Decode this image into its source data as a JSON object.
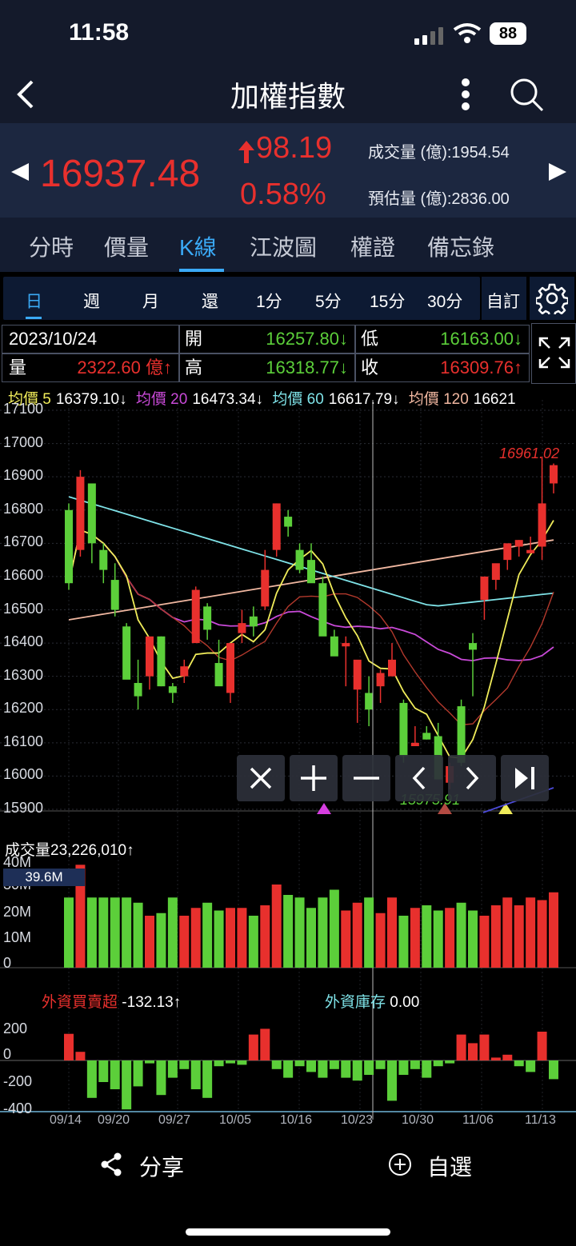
{
  "status_bar": {
    "time": "11:58",
    "battery": "88"
  },
  "header": {
    "title": "加權指數"
  },
  "quote": {
    "price": "16937.48",
    "change": "98.19",
    "change_pct": "0.58%",
    "volume_label": "成交量 (億):1954.54",
    "est_volume_label": "預估量 (億):2836.00"
  },
  "tabs": [
    "分時",
    "價量",
    "K線",
    "江波圖",
    "權證",
    "備忘錄"
  ],
  "active_tab": "K線",
  "periods": [
    "日",
    "週",
    "月",
    "還",
    "1分",
    "5分",
    "15分",
    "30分"
  ],
  "active_period": "日",
  "custom_label": "自訂",
  "ohlc": {
    "date": "2023/10/24",
    "open_label": "開",
    "open": "16257.80↓",
    "low_label": "低",
    "low": "16163.00↓",
    "vol_label": "量",
    "vol": "2322.60 億↑",
    "high_label": "高",
    "high": "16318.77↓",
    "close_label": "收",
    "close": "16309.76↑"
  },
  "ma": [
    {
      "label": "均價 5",
      "value": "16379.10↓",
      "color": "#f0ec5a"
    },
    {
      "label": "均價 20",
      "value": "16473.34↓",
      "color": "#c94ad8"
    },
    {
      "label": "均價 60",
      "value": "16617.79↓",
      "color": "#7fe3e8"
    },
    {
      "label": "均價 120",
      "value": "16621",
      "color": "#f0b7a0"
    }
  ],
  "price_axis": [
    "17100",
    "17000",
    "16900",
    "16800",
    "16700",
    "16600",
    "16500",
    "16400",
    "16300",
    "16200",
    "16100",
    "16000",
    "15900"
  ],
  "high_marker": "16961.02",
  "low_marker": "15975.91",
  "volume": {
    "label": "成交量",
    "value": "23,226,010↑",
    "axis": [
      "40M",
      "30M",
      "20M",
      "10M",
      "0"
    ],
    "cursor_value": "39.6M"
  },
  "foreign": {
    "label": "外資買賣超",
    "value": "-132.13↑",
    "inv_label": "外資庫存",
    "inv_value": "0.00",
    "axis": [
      "200",
      "0",
      "-200",
      "-400"
    ]
  },
  "dates": [
    "09/14",
    "09/20",
    "09/27",
    "10/05",
    "10/16",
    "10/23",
    "10/30",
    "11/06",
    "11/13"
  ],
  "bottom": {
    "share": "分享",
    "watch": "自選"
  },
  "chart_data": {
    "type": "candlestick",
    "candles": [
      [
        16800,
        16820,
        16560,
        16580
      ],
      [
        16680,
        16920,
        16660,
        16900
      ],
      [
        16880,
        16880,
        16640,
        16700
      ],
      [
        16680,
        16700,
        16580,
        16620
      ],
      [
        16590,
        16640,
        16480,
        16500
      ],
      [
        16450,
        16460,
        16300,
        16290
      ],
      [
        16280,
        16350,
        16200,
        16240
      ],
      [
        16300,
        16400,
        16260,
        16420
      ],
      [
        16420,
        16420,
        16270,
        16270
      ],
      [
        16270,
        16280,
        16220,
        16250
      ],
      [
        16300,
        16350,
        16280,
        16330
      ],
      [
        16400,
        16570,
        16420,
        16560
      ],
      [
        16510,
        16520,
        16410,
        16440
      ],
      [
        16340,
        16410,
        16280,
        16270
      ],
      [
        16250,
        16360,
        16220,
        16400
      ],
      [
        16430,
        16500,
        16400,
        16460
      ],
      [
        16480,
        16510,
        16420,
        16450
      ],
      [
        16510,
        16680,
        16500,
        16620
      ],
      [
        16680,
        16820,
        16660,
        16820
      ],
      [
        16780,
        16800,
        16720,
        16750
      ],
      [
        16680,
        16700,
        16610,
        16620
      ],
      [
        16650,
        16700,
        16590,
        16580
      ],
      [
        16580,
        16600,
        16450,
        16420
      ],
      [
        16420,
        16440,
        16400,
        16360
      ],
      [
        16390,
        16420,
        16270,
        16400
      ],
      [
        16260,
        16320,
        16160,
        16350
      ],
      [
        16250,
        16300,
        16150,
        16200
      ],
      [
        16270,
        16320,
        16220,
        16310
      ],
      [
        16300,
        16400,
        16300,
        16350
      ],
      [
        16220,
        16230,
        16040,
        16060
      ],
      [
        16090,
        16150,
        16090,
        16100
      ],
      [
        16130,
        16150,
        16110,
        16110
      ],
      [
        16120,
        16160,
        15990,
        15990
      ],
      [
        15980,
        16040,
        15960,
        16030
      ],
      [
        16210,
        16230,
        16030,
        16040
      ],
      [
        16400,
        16430,
        16240,
        16380
      ],
      [
        16530,
        16600,
        16470,
        16600
      ],
      [
        16590,
        16630,
        16560,
        16640
      ],
      [
        16650,
        16690,
        16620,
        16700
      ],
      [
        16690,
        16710,
        16660,
        16710
      ],
      [
        16670,
        16720,
        16670,
        16680
      ],
      [
        16690,
        16960,
        16650,
        16820
      ],
      [
        16880,
        16940,
        16850,
        16935
      ]
    ],
    "volume_M": [
      27,
      39.6,
      27,
      27,
      27,
      27,
      25,
      20,
      21,
      27,
      20,
      23,
      25,
      22,
      23,
      23,
      20,
      24,
      32,
      28,
      27,
      23,
      27,
      30,
      22,
      25,
      27,
      21,
      27,
      20,
      23,
      24,
      22,
      23,
      25,
      22,
      20,
      24,
      27,
      24,
      27,
      26,
      29
    ],
    "foreign_net": [
      185,
      60,
      -260,
      -150,
      -200,
      -340,
      -180,
      -20,
      -240,
      -120,
      -60,
      -200,
      -260,
      -40,
      -20,
      -30,
      180,
      220,
      -60,
      -120,
      -40,
      -80,
      -120,
      -60,
      -120,
      -140,
      -100,
      -60,
      -280,
      -100,
      -60,
      -120,
      -40,
      -20,
      180,
      120,
      180,
      20,
      40,
      -40,
      -80,
      200,
      -130
    ],
    "ylim": [
      15900,
      17100
    ]
  }
}
